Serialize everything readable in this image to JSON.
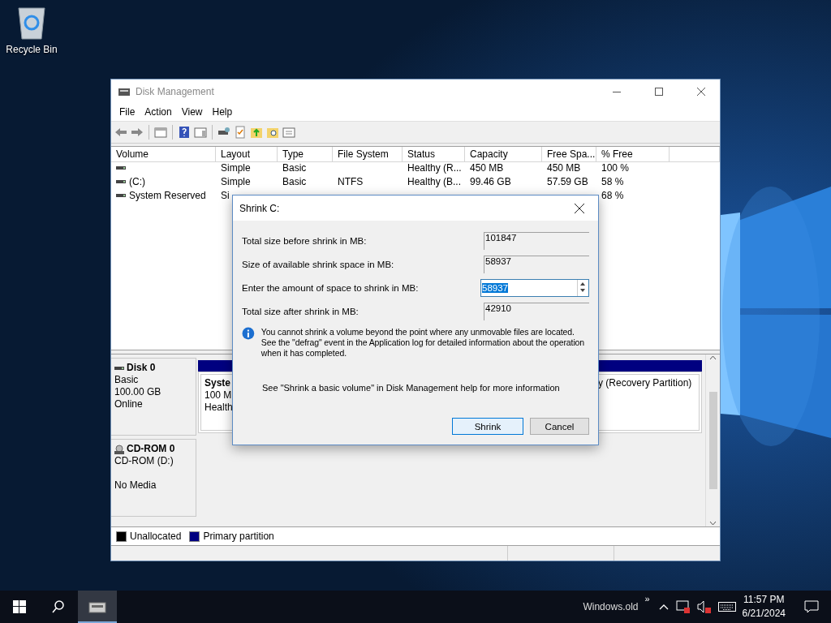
{
  "desktop": {
    "icons": [
      {
        "label": "Recycle Bin"
      }
    ]
  },
  "window": {
    "title": "Disk Management",
    "menu": [
      "File",
      "Action",
      "View",
      "Help"
    ]
  },
  "table": {
    "columns": [
      "Volume",
      "Layout",
      "Type",
      "File System",
      "Status",
      "Capacity",
      "Free Spa...",
      "% Free"
    ],
    "rows": [
      {
        "cells": [
          null,
          "Simple",
          "Basic",
          null,
          "Healthy (R...",
          "450 MB",
          "450 MB",
          "100 %"
        ]
      },
      {
        "cells": [
          "(C:)",
          "Simple",
          "Basic",
          "NTFS",
          "Healthy (B...",
          "99.46 GB",
          "57.59 GB",
          "58 %"
        ]
      },
      {
        "cells": [
          "System Reserved",
          "Si",
          null,
          null,
          null,
          null,
          null,
          "68 %"
        ]
      }
    ]
  },
  "disks": [
    {
      "kind": "disk",
      "name": "Disk 0",
      "type": "Basic",
      "size": "100.00 GB",
      "status": "Online",
      "partitions": [
        {
          "kind": "volume",
          "lines": [
            "Syste",
            "100 M",
            "Health"
          ]
        },
        {
          "kind": "volume",
          "lines": [
            "y (Recovery Partition)"
          ]
        }
      ]
    },
    {
      "kind": "cdrom",
      "name": "CD-ROM 0",
      "type": "CD-ROM (D:)",
      "status": "No Media"
    }
  ],
  "legend": [
    {
      "label": "Unallocated",
      "color": "#000000"
    },
    {
      "label": "Primary partition",
      "color": "#000080"
    }
  ],
  "dialog": {
    "title": "Shrink C:",
    "fields": [
      {
        "kind": "readonly",
        "label": "Total size before shrink in MB:",
        "value": "101847"
      },
      {
        "kind": "readonly",
        "label": "Size of available shrink space in MB:",
        "value": "58937"
      },
      {
        "kind": "spin",
        "label": "Enter the amount of space to shrink in MB:",
        "value": "58937",
        "selected": true
      },
      {
        "kind": "readonly",
        "label": "Total size after shrink in MB:",
        "value": "42910"
      }
    ],
    "info": "You cannot shrink a volume beyond the point where any unmovable files are located. See the \"defrag\" event in the Application log for detailed information about the operation when it has completed.",
    "help": "See \"Shrink a basic volume\" in Disk Management help for more information",
    "buttons": [
      {
        "label": "Shrink",
        "default": true
      },
      {
        "label": "Cancel",
        "default": false
      }
    ]
  },
  "taskbar": {
    "apps": [
      {
        "active": true
      }
    ],
    "toolbar_label": "Windows.old",
    "overflow": "»",
    "time": "11:57 PM",
    "date": "6/21/2024"
  }
}
